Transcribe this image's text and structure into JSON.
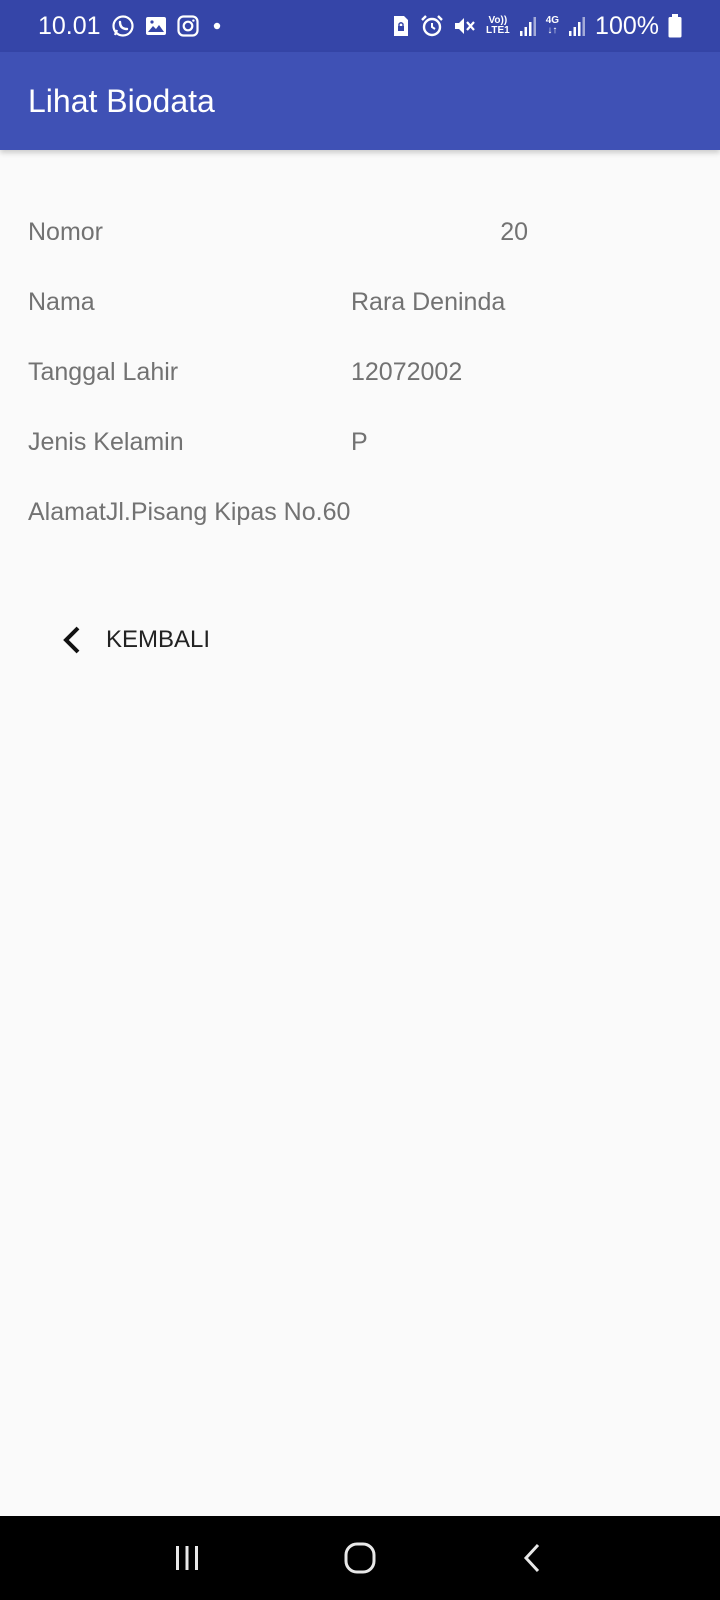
{
  "status_bar": {
    "time": "10.01",
    "battery": "100%",
    "volte": "Vo))",
    "lte": "LTE1",
    "network": "4G",
    "icons_left": [
      "whatsapp-icon",
      "gallery-icon",
      "instagram-icon",
      "dot-icon"
    ],
    "icons_right": [
      "sim-lock-icon",
      "alarm-icon",
      "mute-icon",
      "volte-icon",
      "signal-icon",
      "4g-icon",
      "signal-icon-2",
      "battery-icon"
    ]
  },
  "app_bar": {
    "title": "Lihat Biodata"
  },
  "biodata": {
    "nomor_label": "Nomor",
    "nomor_value": "20",
    "nama_label": "Nama",
    "nama_value": "Rara Deninda",
    "tgl_label": "Tanggal Lahir",
    "tgl_value": "12072002",
    "jk_label": "Jenis Kelamin",
    "jk_value": "P",
    "alamat_label": "Alamat",
    "alamat_value": "Jl.Pisang Kipas No.60"
  },
  "back_button": {
    "label": "KEMBALI",
    "icon": "chevron-left-icon"
  },
  "nav_bar": {
    "icons": [
      "recent-apps-icon",
      "home-icon",
      "back-icon"
    ]
  },
  "colors": {
    "status_bar": "#3545a8",
    "app_bar": "#3f51b5",
    "background": "#fafafa",
    "text": "#727272",
    "nav_bar": "#000000"
  }
}
